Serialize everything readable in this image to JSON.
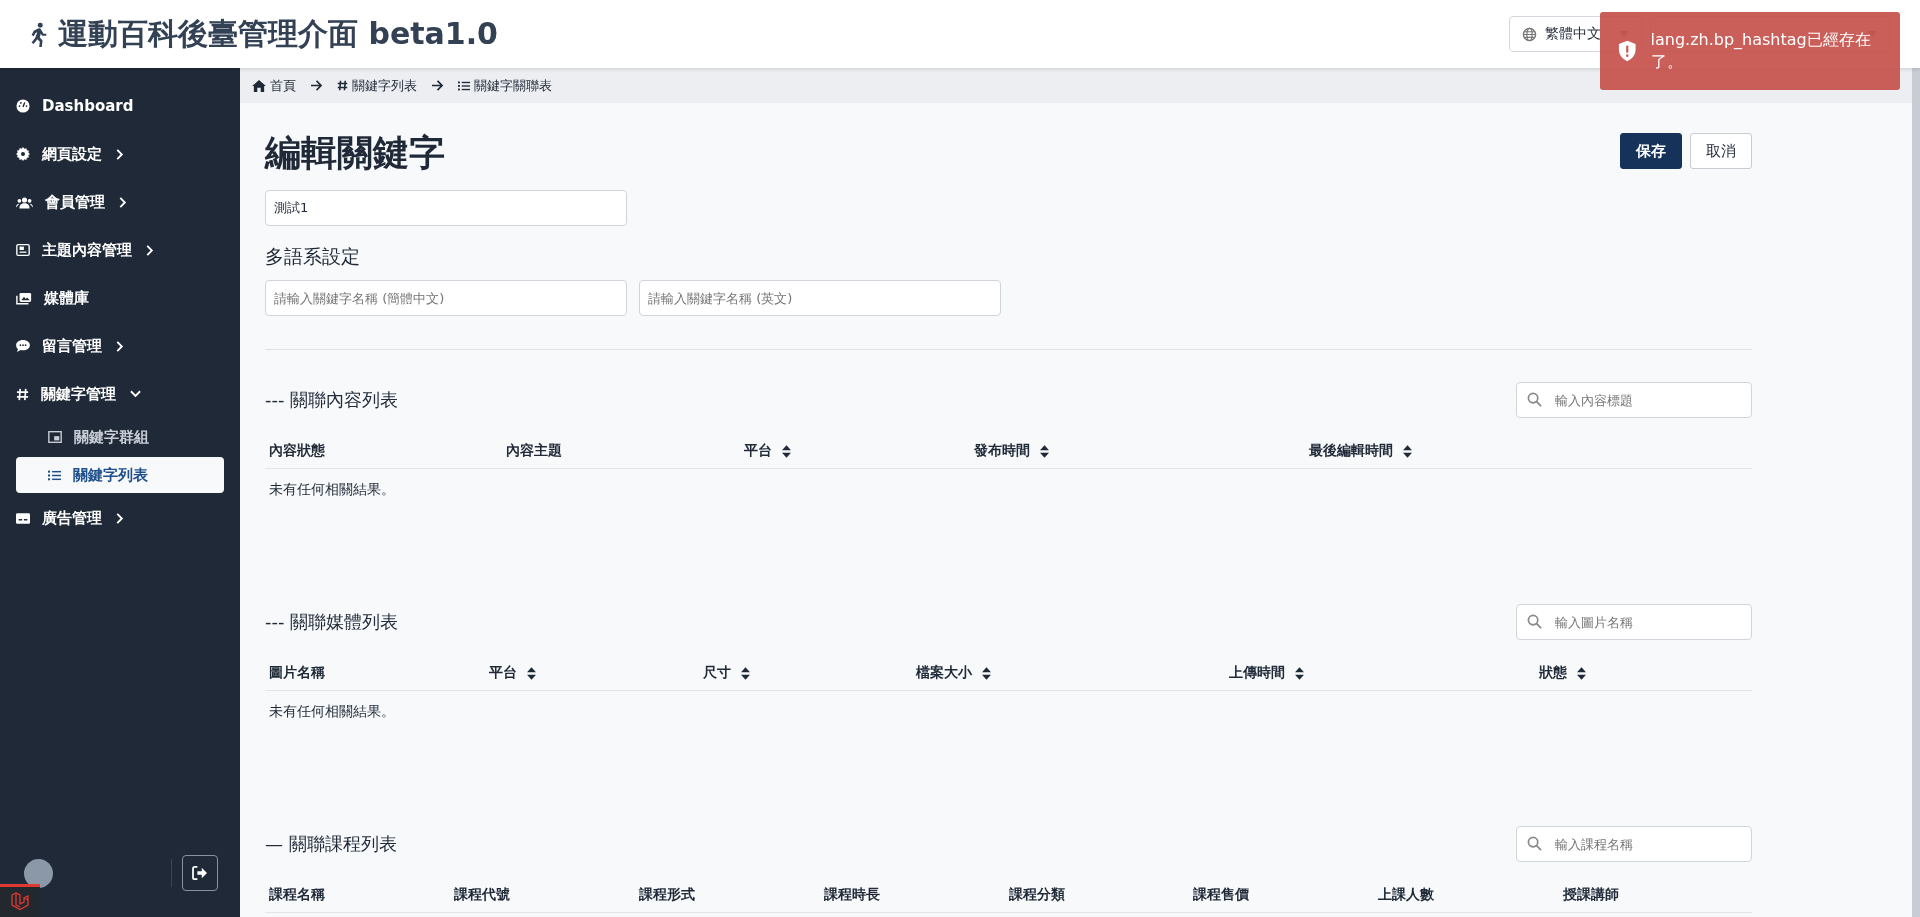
{
  "header": {
    "title": "運動百科後臺管理介面 beta1.0",
    "language_select": {
      "value": "繁體中文"
    }
  },
  "toast": {
    "message": "lang.zh.bp_hashtag已經存在了。"
  },
  "sidebar": {
    "items": [
      {
        "label": "Dashboard"
      },
      {
        "label": "網頁設定",
        "expanded": false
      },
      {
        "label": "會員管理",
        "expanded": false
      },
      {
        "label": "主題內容管理",
        "expanded": false
      },
      {
        "label": "媒體庫"
      },
      {
        "label": "留言管理",
        "expanded": false
      },
      {
        "label": "關鍵字管理",
        "expanded": true,
        "children": [
          {
            "label": "關鍵字群組",
            "selected": false
          },
          {
            "label": "關鍵字列表",
            "selected": true
          }
        ]
      },
      {
        "label": "廣告管理",
        "expanded": false
      }
    ]
  },
  "breadcrumb": [
    "首頁",
    "關鍵字列表",
    "關鍵字關聯表"
  ],
  "page": {
    "title": "編輯關鍵字",
    "buttons": [
      {
        "label": "保存",
        "kind": "primary"
      },
      {
        "label": "取消",
        "kind": "secondary"
      }
    ],
    "name_field": {
      "value": "測試1"
    },
    "i18n_heading": "多語系設定",
    "i18n_fields": [
      {
        "placeholder": "請輸入關鍵字名稱 (簡體中文)"
      },
      {
        "placeholder": "請輸入關鍵字名稱 (英文)"
      }
    ]
  },
  "sections": [
    {
      "title": "--- 關聯內容列表",
      "search_placeholder": "輸入內容標題",
      "columns": [
        {
          "label": "內容狀態",
          "sortable": false
        },
        {
          "label": "內容主題",
          "sortable": false
        },
        {
          "label": "平台",
          "sortable": true
        },
        {
          "label": "發布時間",
          "sortable": true
        },
        {
          "label": "最後編輯時間",
          "sortable": true
        }
      ],
      "empty_text": "未有任何相關結果。"
    },
    {
      "title": "--- 關聯媒體列表",
      "search_placeholder": "輸入圖片名稱",
      "columns": [
        {
          "label": "圖片名稱",
          "sortable": false
        },
        {
          "label": "平台",
          "sortable": true
        },
        {
          "label": "尺寸",
          "sortable": true
        },
        {
          "label": "檔案大小",
          "sortable": true
        },
        {
          "label": "上傳時間",
          "sortable": true
        },
        {
          "label": "狀態",
          "sortable": true
        }
      ],
      "empty_text": "未有任何相關結果。"
    },
    {
      "title": "— 關聯課程列表",
      "search_placeholder": "輸入課程名稱",
      "columns": [
        {
          "label": "課程名稱",
          "sortable": false
        },
        {
          "label": "課程代號",
          "sortable": false
        },
        {
          "label": "課程形式",
          "sortable": false
        },
        {
          "label": "課程時長",
          "sortable": false
        },
        {
          "label": "課程分類",
          "sortable": false
        },
        {
          "label": "課程售價",
          "sortable": false
        },
        {
          "label": "上課人數",
          "sortable": false
        },
        {
          "label": "授課講師",
          "sortable": false
        }
      ]
    }
  ]
}
